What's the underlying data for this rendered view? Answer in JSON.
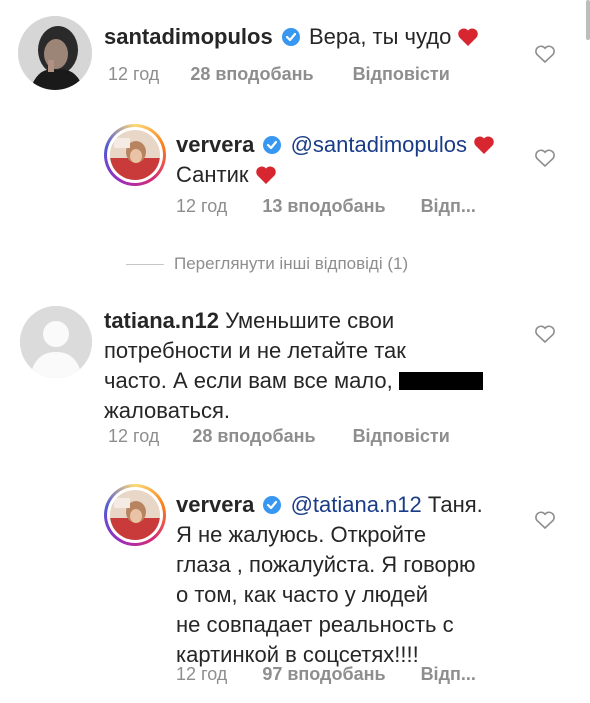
{
  "comments": [
    {
      "username": "santadimopulos",
      "verified": true,
      "text": "Вера, ты чудо",
      "heart": true,
      "time": "12 год",
      "likes": "28 вподобань",
      "reply": "Відповісти"
    },
    {
      "username": "ververa",
      "verified": true,
      "mention": "@santadimopulos",
      "text": "Сантик",
      "time": "12 год",
      "likes": "13 вподобань",
      "reply": "Відп..."
    },
    {
      "username": "tatiana.n12",
      "verified": false,
      "line1": "Уменьшите свои",
      "line2": "потребности и не летайте так",
      "line3": "часто. А если вам все мало,",
      "line4": "жаловаться.",
      "time": "12 год",
      "likes": "28 вподобань",
      "reply": "Відповісти"
    },
    {
      "username": "ververa",
      "verified": true,
      "mention": "@tatiana.n12",
      "line1": "Таня.",
      "line2": "Я не жалуюсь. Откройте",
      "line3": "глаза , пожалуйста. Я говорю",
      "line4": "о том, как часто у людей",
      "line5": "не совпадает реальность с",
      "line6": "картинкой в соцсетях!!!!",
      "time": "12 год",
      "likes": "97 вподобань",
      "reply": "Відп..."
    }
  ],
  "view_more": "Переглянути інші відповіді (1)",
  "colors": {
    "text": "#262626",
    "meta": "#8e8e8e",
    "mention": "#1a3c87",
    "verified": "#3897f0",
    "heart": "#ed4956"
  },
  "icons": [
    "verified-badge-icon",
    "heart-emoji-icon",
    "like-heart-outline-icon"
  ]
}
